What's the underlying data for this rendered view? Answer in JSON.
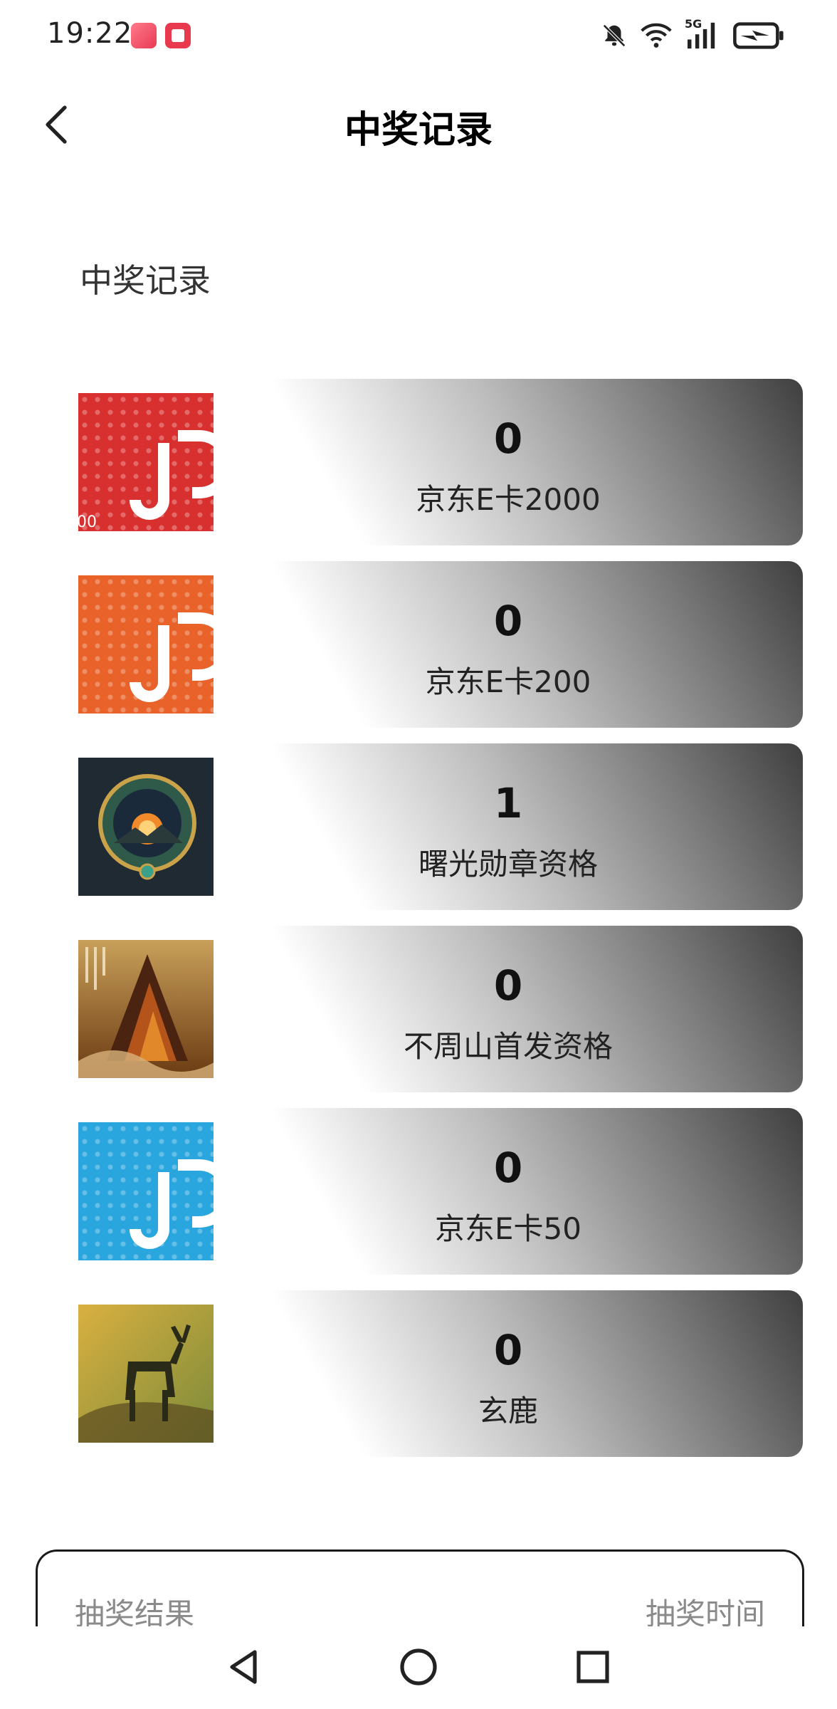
{
  "status_bar": {
    "time": "19:22",
    "network_label": "5G",
    "icons": [
      "app-badge-icon",
      "app-red-icon",
      "bell-muted-icon",
      "wifi-icon",
      "signal-icon",
      "battery-charging-icon"
    ]
  },
  "nav": {
    "title": "中奖记录",
    "back_icon": "chevron-left-icon"
  },
  "section": {
    "title": "中奖记录"
  },
  "records": [
    {
      "count": "0",
      "name": "京东E卡2000",
      "thumb": "jd-card-red",
      "color": "#d8302f"
    },
    {
      "count": "0",
      "name": "京东E卡200",
      "thumb": "jd-card-orange",
      "color": "#e8622a"
    },
    {
      "count": "1",
      "name": "曙光勋章资格",
      "thumb": "dawn-medal-art",
      "color": "#2a3a44"
    },
    {
      "count": "0",
      "name": "不周山首发资格",
      "thumb": "buzhou-mountain-art",
      "color": "#8a4a1a"
    },
    {
      "count": "0",
      "name": "京东E卡50",
      "thumb": "jd-card-blue",
      "color": "#2aa6de"
    },
    {
      "count": "0",
      "name": "玄鹿",
      "thumb": "xuan-deer-art",
      "color": "#b8902a"
    }
  ],
  "table": {
    "result_header": "抽奖结果",
    "time_header": "抽奖时间"
  },
  "system_nav": {
    "icons": [
      "back-triangle-icon",
      "home-circle-icon",
      "recents-square-icon"
    ]
  }
}
